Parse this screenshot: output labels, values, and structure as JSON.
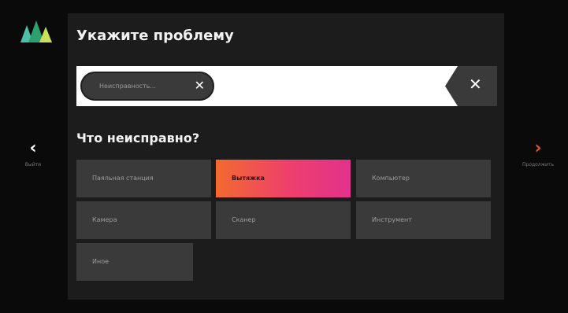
{
  "title": "Укажите проблему",
  "search": {
    "chip_label": "Неисправность...",
    "chip_close": "✕",
    "clear": "✕"
  },
  "question": "Что неисправно?",
  "options": [
    {
      "label": "Паяльная станция",
      "selected": false
    },
    {
      "label": "Вытяжка",
      "selected": true
    },
    {
      "label": "Компьютер",
      "selected": false
    },
    {
      "label": "Камера",
      "selected": false
    },
    {
      "label": "Сканер",
      "selected": false
    },
    {
      "label": "Инструмент",
      "selected": false
    },
    {
      "label": "Иное",
      "selected": false
    }
  ],
  "nav": {
    "back_arrow": "‹",
    "back_label": "Выйти",
    "next_arrow": "›",
    "next_label": "Продолжить"
  },
  "colors": {
    "accent_orange": "#f26a2f",
    "accent_pink": "#e2328c",
    "tile": "#3a3a3a",
    "panel": "#1c1c1c"
  }
}
